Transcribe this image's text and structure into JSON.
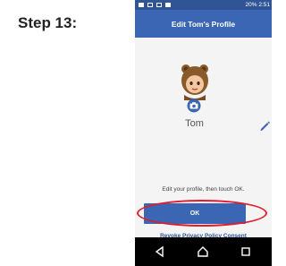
{
  "step_label": "Step 13:",
  "status_bar": {
    "right_text": "20% 2:51"
  },
  "app_bar": {
    "title": "Edit Tom's Profile"
  },
  "profile": {
    "name": "Tom"
  },
  "instruction": "Edit your profile, then touch OK.",
  "ok_button": "OK",
  "revoke_link": "Revoke Privacy Policy Consent",
  "colors": {
    "primary": "#3a66b3",
    "highlight": "#e21c2a"
  },
  "icons": {
    "avatar": "bear-hat-avatar-icon",
    "camera": "camera-icon",
    "edit": "pencil-icon",
    "back": "back-triangle-icon",
    "home": "home-icon",
    "recents": "recents-square-icon"
  }
}
